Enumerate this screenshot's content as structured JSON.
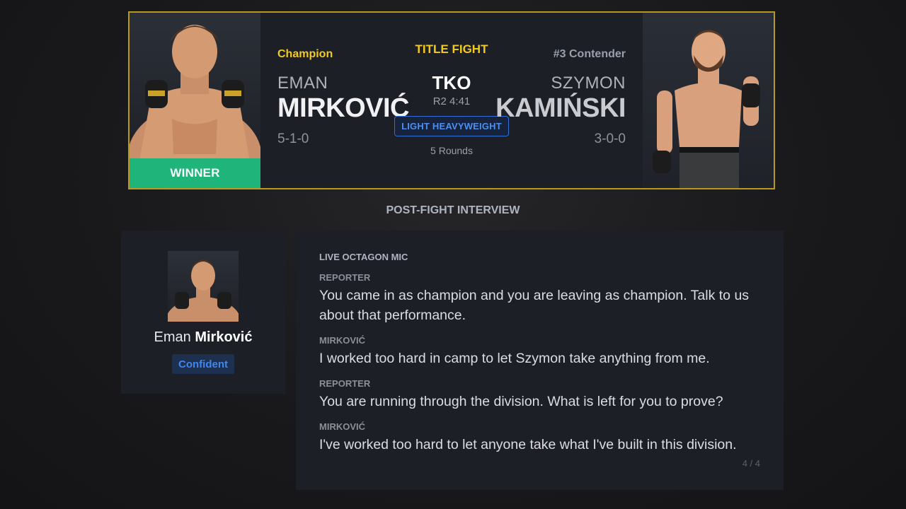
{
  "fight": {
    "winner": {
      "tag": "Champion",
      "first_name": "EMAN",
      "last_name": "MIRKOVIĆ",
      "record": "5-1-0",
      "result_label": "WINNER"
    },
    "loser": {
      "tag": "#3 Contender",
      "first_name": "SZYMON",
      "last_name": "KAMIŃSKI",
      "record": "3-0-0"
    },
    "title_label": "TITLE FIGHT",
    "method": "TKO",
    "time": "R2 4:41",
    "weight_class": "LIGHT HEAVYWEIGHT",
    "rounds": "5 Rounds"
  },
  "interview": {
    "heading": "POST-FIGHT INTERVIEW",
    "speaker": {
      "first_name": "Eman",
      "last_name": "Mirković",
      "mood": "Confident"
    },
    "channel": "LIVE OCTAGON MIC",
    "lines": [
      {
        "speaker": "REPORTER",
        "text": "You came in as champion and you are leaving as champion. Talk to us about that performance."
      },
      {
        "speaker": "MIRKOVIĆ",
        "text": "I worked too hard in camp to let Szymon take anything from me."
      },
      {
        "speaker": "REPORTER",
        "text": "You are running through the division. What is left for you to prove?"
      },
      {
        "speaker": "MIRKOVIĆ",
        "text": "I've worked too hard to let anyone take what I've built in this division."
      }
    ],
    "pager": "4 / 4"
  },
  "colors": {
    "accent_gold": "#f3cb1c",
    "winner_green": "#1eb47a",
    "badge_blue": "#3f86ee"
  }
}
